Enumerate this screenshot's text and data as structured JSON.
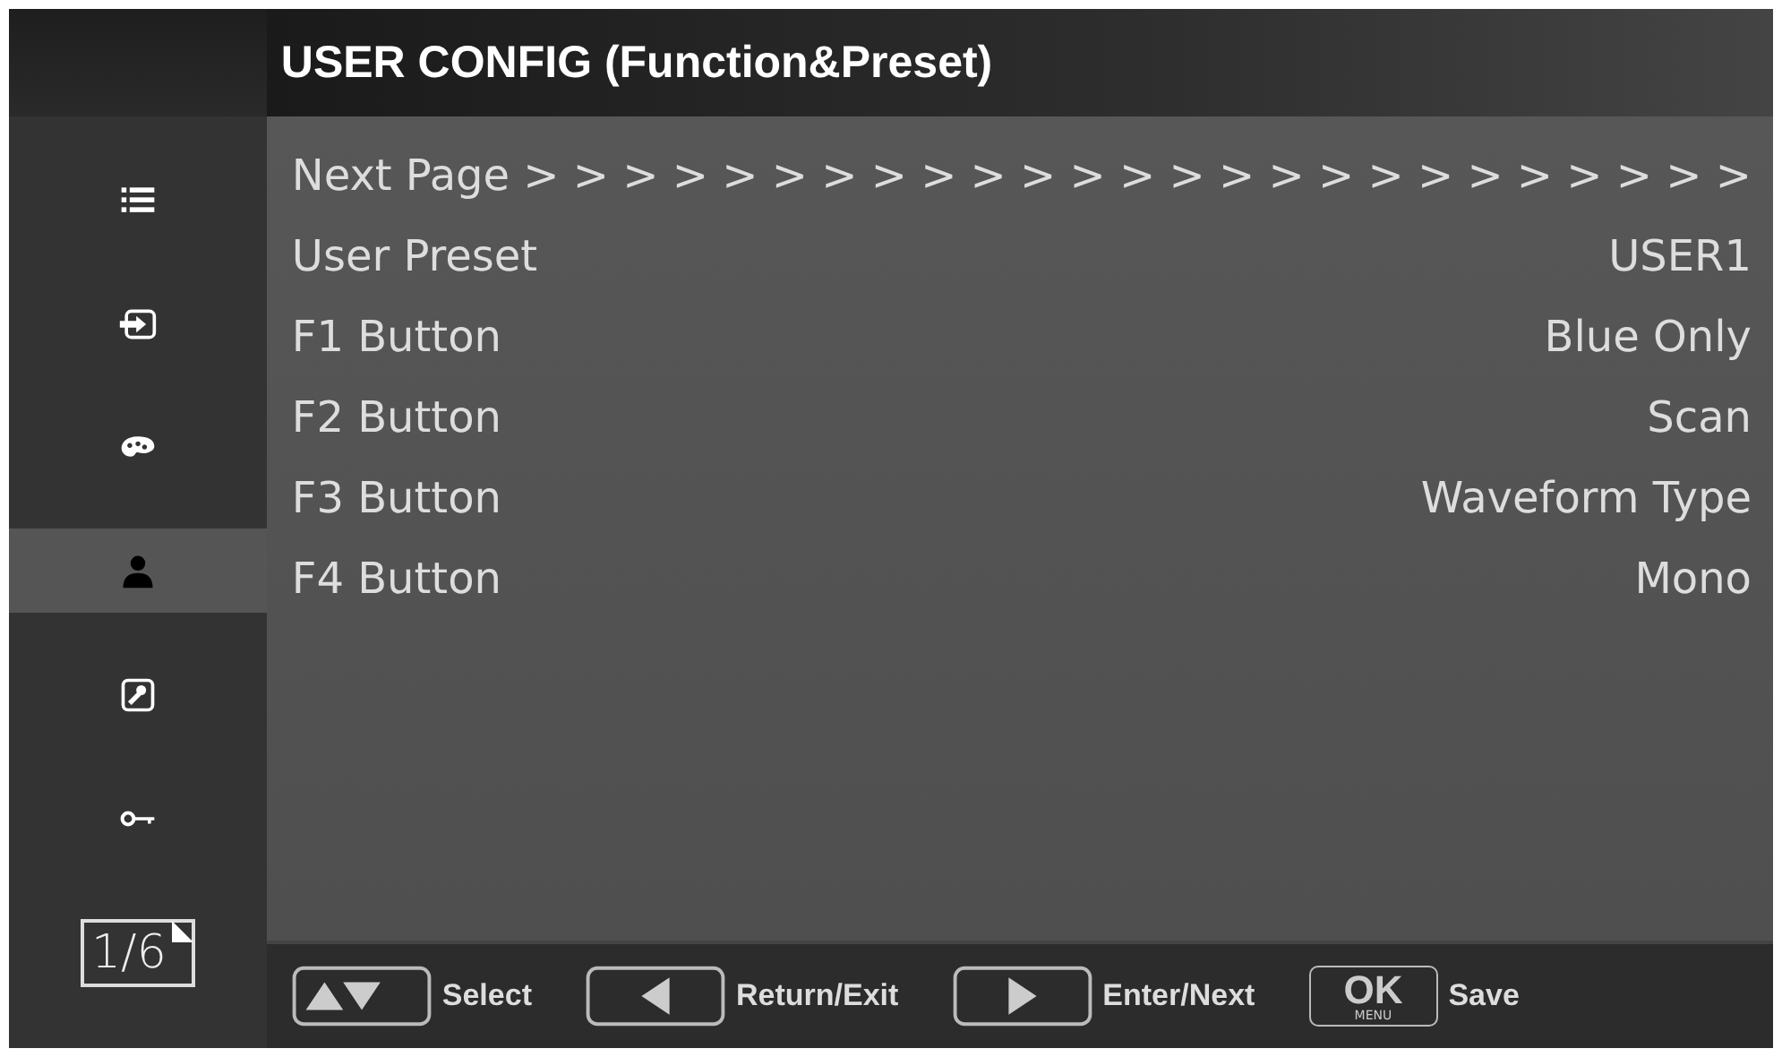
{
  "title": "USER CONFIG (Function&Preset)",
  "sidebar": {
    "items": [
      {
        "kind": "list",
        "selected": false
      },
      {
        "kind": "input",
        "selected": false
      },
      {
        "kind": "palette",
        "selected": false
      },
      {
        "kind": "user",
        "selected": true
      },
      {
        "kind": "wrench",
        "selected": false
      },
      {
        "kind": "key",
        "selected": false
      }
    ],
    "page": "1/6"
  },
  "rows": [
    {
      "kind": "link",
      "label": "Next Page > > > > > > > > > > > > > > > > > > > > > > > > >"
    },
    {
      "kind": "setting",
      "label": "User Preset",
      "value": "USER1"
    },
    {
      "kind": "setting",
      "label": "F1 Button",
      "value": "Blue Only"
    },
    {
      "kind": "setting",
      "label": "F2 Button",
      "value": "Scan"
    },
    {
      "kind": "setting",
      "label": "F3 Button",
      "value": "Waveform Type"
    },
    {
      "kind": "setting",
      "label": "F4 Button",
      "value": "Mono"
    }
  ],
  "hints": [
    {
      "kind": "updown",
      "label": "Select"
    },
    {
      "kind": "left",
      "label": "Return/Exit"
    },
    {
      "kind": "right",
      "label": "Enter/Next"
    },
    {
      "kind": "ok",
      "key_text": "OK",
      "key_subtext": "MENU",
      "label": "Save"
    }
  ]
}
